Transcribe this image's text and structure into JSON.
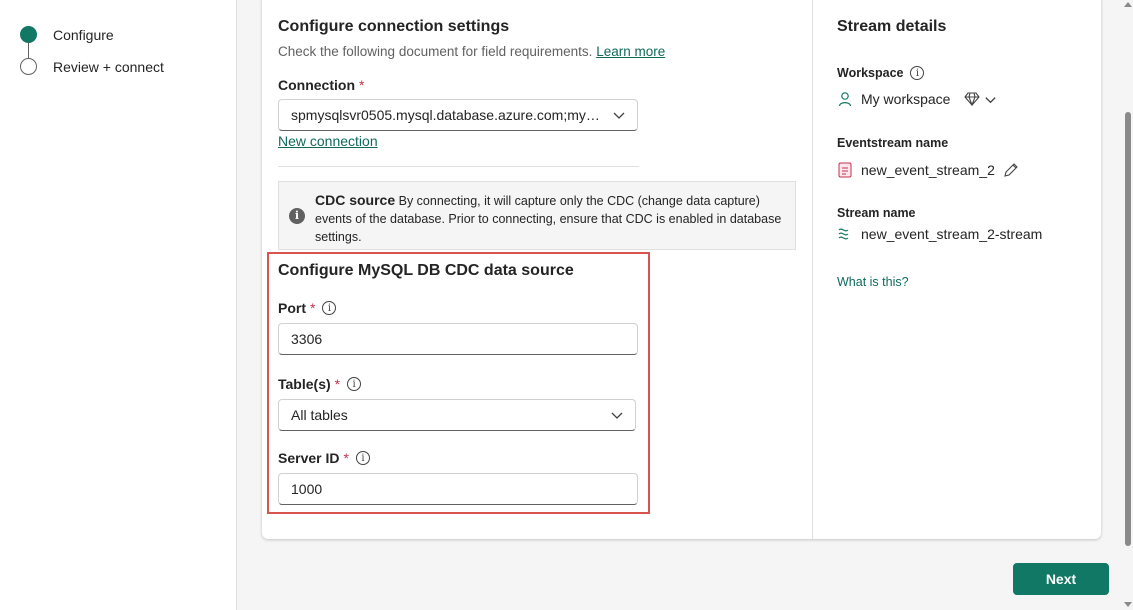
{
  "stepper": {
    "steps": [
      {
        "label": "Configure",
        "state": "active"
      },
      {
        "label": "Review + connect",
        "state": "inactive"
      }
    ]
  },
  "configure": {
    "title": "Configure connection settings",
    "description": "Check the following document for field requirements.",
    "learn_more": "Learn more",
    "connection": {
      "label": "Connection",
      "required": "*",
      "value": "spmysqlsvr0505.mysql.database.azure.com;mysq..."
    },
    "new_connection": "New connection",
    "notice": {
      "title": "CDC source",
      "text": "By connecting, it will capture only the CDC (change data capture) events of the database. Prior to connecting, ensure that CDC is enabled in database settings."
    },
    "source": {
      "title": "Configure MySQL DB CDC data source",
      "port": {
        "label": "Port",
        "required": "*",
        "value": "3306"
      },
      "tables": {
        "label": "Table(s)",
        "required": "*",
        "value": "All tables"
      },
      "server_id": {
        "label": "Server ID",
        "required": "*",
        "value": "1000"
      }
    }
  },
  "details": {
    "title": "Stream details",
    "workspace_label": "Workspace",
    "workspace_value": "My workspace",
    "eventstream_label": "Eventstream name",
    "eventstream_value": "new_event_stream_2",
    "stream_label": "Stream name",
    "stream_value": "new_event_stream_2-stream",
    "what_is_this": "What is this?"
  },
  "footer": {
    "next_label": "Next"
  },
  "colors": {
    "accent": "#117865",
    "link": "#0f6a5d",
    "required": "#c4314b",
    "highlight": "#d9534f"
  },
  "icons": [
    "info-icon",
    "chevron-down-icon",
    "person-icon",
    "diamond-icon",
    "eventstream-icon",
    "pencil-icon",
    "stream-icon"
  ]
}
